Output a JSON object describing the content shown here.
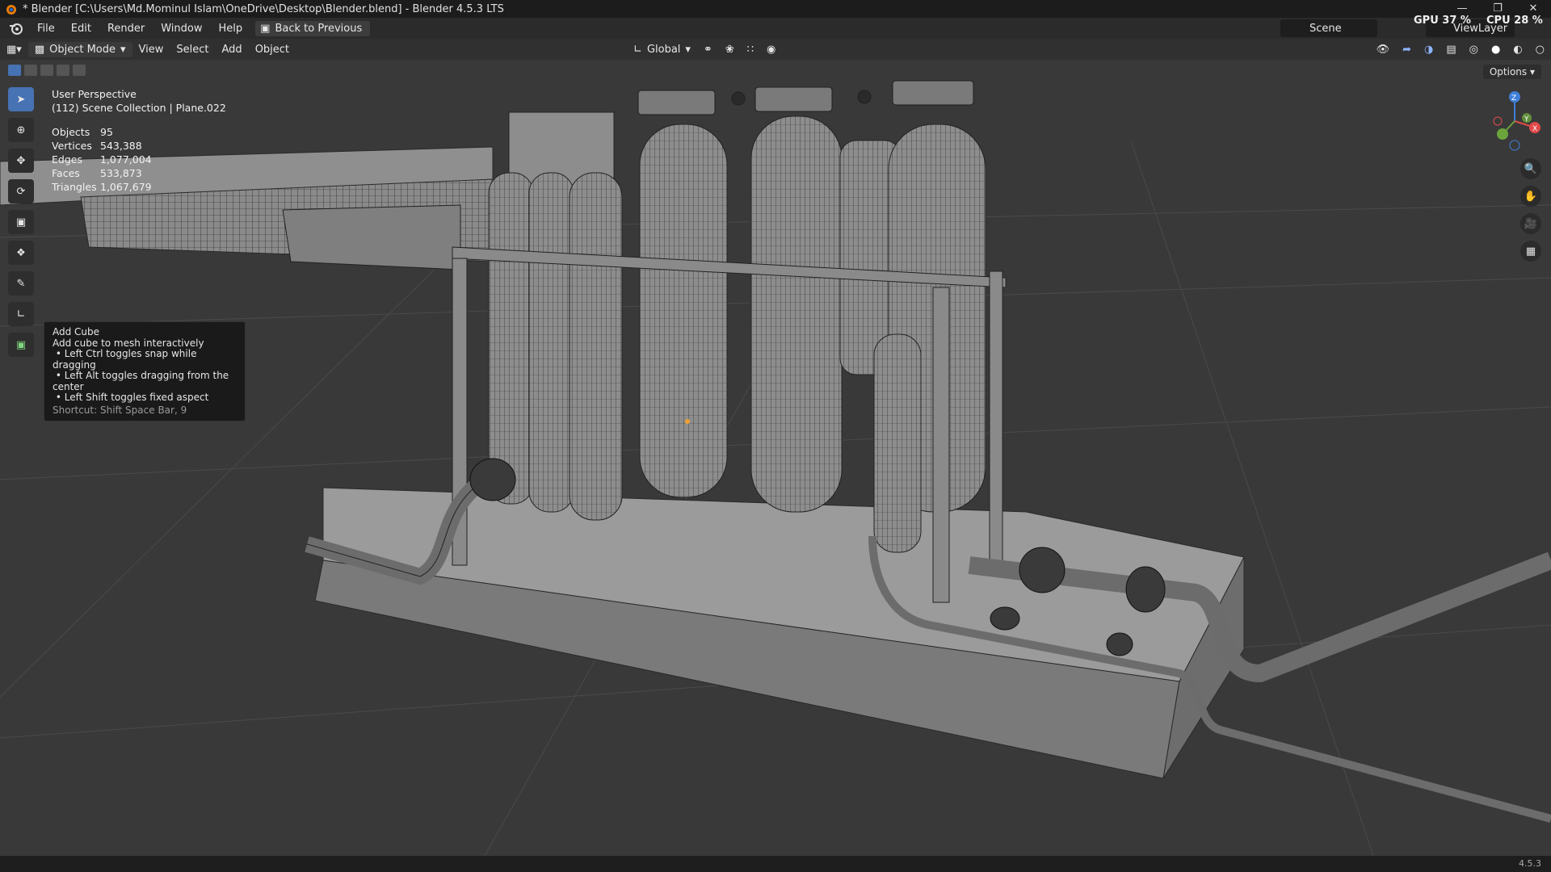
{
  "window": {
    "title": "* Blender [C:\\Users\\Md.Mominul Islam\\OneDrive\\Desktop\\Blender.blend] - Blender 4.5.3 LTS"
  },
  "menubar": {
    "items": [
      "File",
      "Edit",
      "Render",
      "Window",
      "Help"
    ],
    "back_button": "Back to Previous",
    "scene_label": "Scene",
    "viewlayer_label": "ViewLayer",
    "gpu_label": "GPU",
    "gpu_value": "37 %",
    "cpu_label": "CPU",
    "cpu_value": "28 %"
  },
  "header": {
    "mode": "Object Mode",
    "menus": [
      "View",
      "Select",
      "Add",
      "Object"
    ],
    "transform_orientation": "Global",
    "options_label": "Options"
  },
  "viewport": {
    "perspective": "User Perspective",
    "collection": "(112) Scene Collection | Plane.022",
    "stats": [
      {
        "label": "Objects",
        "value": "95"
      },
      {
        "label": "Vertices",
        "value": "543,388"
      },
      {
        "label": "Edges",
        "value": "1,077,004"
      },
      {
        "label": "Faces",
        "value": "533,873"
      },
      {
        "label": "Triangles",
        "value": "1,067,679"
      }
    ]
  },
  "tooltip": {
    "title": "Add Cube",
    "description": "Add cube to mesh interactively",
    "bullets": [
      "Left Ctrl toggles snap while dragging",
      "Left Alt toggles dragging from the center",
      "Left Shift toggles fixed aspect"
    ],
    "shortcut": "Shortcut: Shift Space Bar, 9"
  },
  "gizmo": {
    "x": "X",
    "y": "Y",
    "z": "Z"
  },
  "statusbar": {
    "version": "4.5.3"
  },
  "colors": {
    "active_tool": "#4772b3",
    "viewport_bg": "#393939",
    "axis_x": "#e24a4a",
    "axis_y": "#6ca43c",
    "axis_z": "#3f7fd9"
  }
}
